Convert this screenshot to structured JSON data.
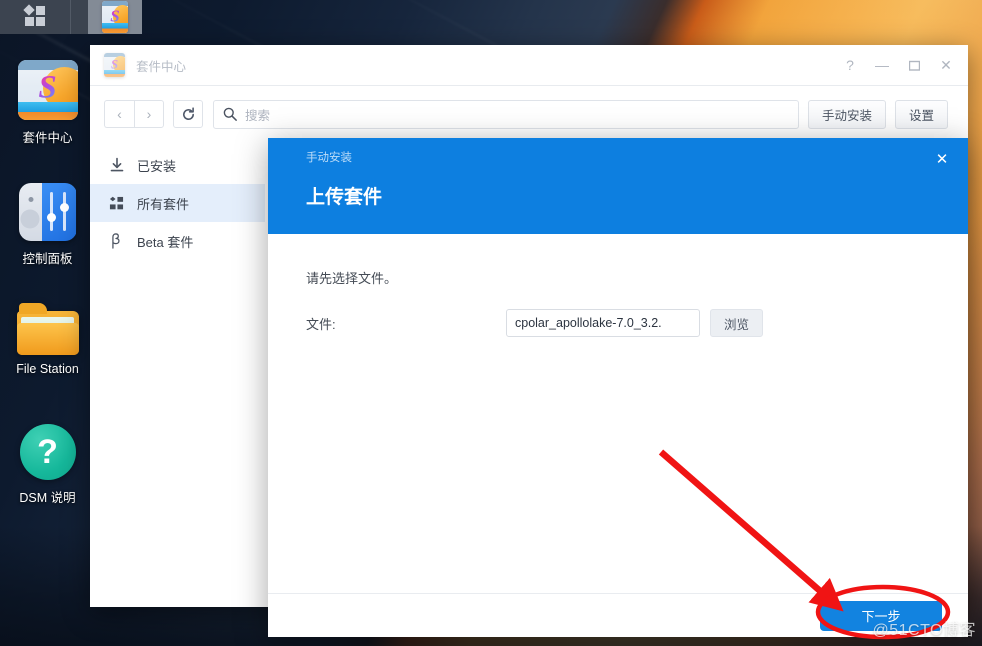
{
  "taskbar": {
    "apps_button_icon": "grid-icon",
    "active_app_icon": "package-center-icon"
  },
  "desktop": {
    "shortcuts": [
      {
        "label": "套件中心",
        "icon": "package-center-icon"
      },
      {
        "label": "控制面板",
        "icon": "control-panel-icon"
      },
      {
        "label": "File Station",
        "icon": "folder-icon"
      },
      {
        "label": "DSM 说明",
        "icon": "help-question-icon"
      }
    ]
  },
  "window": {
    "title": "套件中心",
    "controls": {
      "help": "?",
      "minimize": "—",
      "maximize": "❐",
      "close": "✕"
    },
    "toolbar": {
      "back": "‹",
      "forward": "›",
      "refresh": "⟳",
      "search_placeholder": "搜索",
      "search_value": "",
      "manual_install": "手动安装",
      "settings": "设置"
    },
    "sidebar": {
      "items": [
        {
          "label": "已安装",
          "icon": "download-icon",
          "active": false
        },
        {
          "label": "所有套件",
          "icon": "grid-icon",
          "active": true
        },
        {
          "label": "Beta 套件",
          "icon": "beta-icon",
          "active": false
        }
      ]
    }
  },
  "dialog": {
    "breadcrumb": "手动安装",
    "title": "上传套件",
    "close": "✕",
    "hint": "请先选择文件。",
    "file_label": "文件:",
    "file_value": "cpolar_apollolake-7.0_3.2.",
    "browse_label": "浏览",
    "next_label": "下一步"
  },
  "annotations": {
    "watermark": "@51CTO博客",
    "arrow_color": "#f01414",
    "ellipse_color": "#f01414"
  },
  "colors": {
    "accent": "#0d7fe0",
    "button_primary": "#1283e0",
    "sidebar_active": "#e4eefb",
    "taskbar": "#3c4450"
  }
}
